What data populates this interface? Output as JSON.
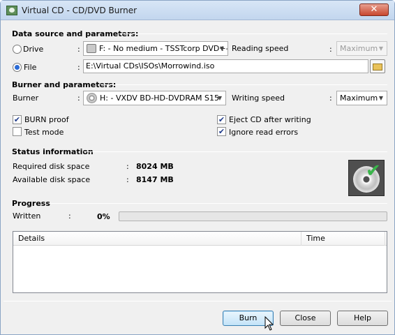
{
  "window": {
    "title": "Virtual CD - CD/DVD Burner",
    "close_label": "✕"
  },
  "source": {
    "header": "Data source and parameters:",
    "drive_label": "Drive",
    "drive_value": "F: - No medium - TSSTcorp DVD+-R",
    "file_label": "File",
    "file_value": "E:\\Virtual CDs\\ISOs\\Morrowind.iso",
    "reading_speed_label": "Reading speed",
    "reading_speed_value": "Maximum",
    "selected": "file"
  },
  "burner": {
    "header": "Burner and parameters:",
    "burner_label": "Burner",
    "burner_value": "H: - VXDV BD-HD-DVDRAM S15",
    "writing_speed_label": "Writing speed",
    "writing_speed_value": "Maximum",
    "options": [
      {
        "label": "BURN proof",
        "checked": true
      },
      {
        "label": "Test mode",
        "checked": false
      },
      {
        "label": "Eject CD after writing",
        "checked": true
      },
      {
        "label": "Ignore read errors",
        "checked": true
      }
    ]
  },
  "status": {
    "header": "Status information",
    "required_label": "Required disk space",
    "required_value": "8024 MB",
    "available_label": "Available disk space",
    "available_value": "8147 MB"
  },
  "progress": {
    "header": "Progress",
    "written_label": "Written",
    "written_value": "0%",
    "fraction": 0.0,
    "columns": [
      "Details",
      "Time"
    ]
  },
  "buttons": {
    "burn": "Burn",
    "close": "Close",
    "help": "Help"
  },
  "colon": ":",
  "colors": {
    "accent": "#2a6bd6",
    "progress": "#37b24d"
  },
  "icons": [
    "app-icon",
    "drive-icon",
    "disc-icon",
    "folder-icon",
    "cd-check-icon",
    "mouse-cursor-icon"
  ]
}
